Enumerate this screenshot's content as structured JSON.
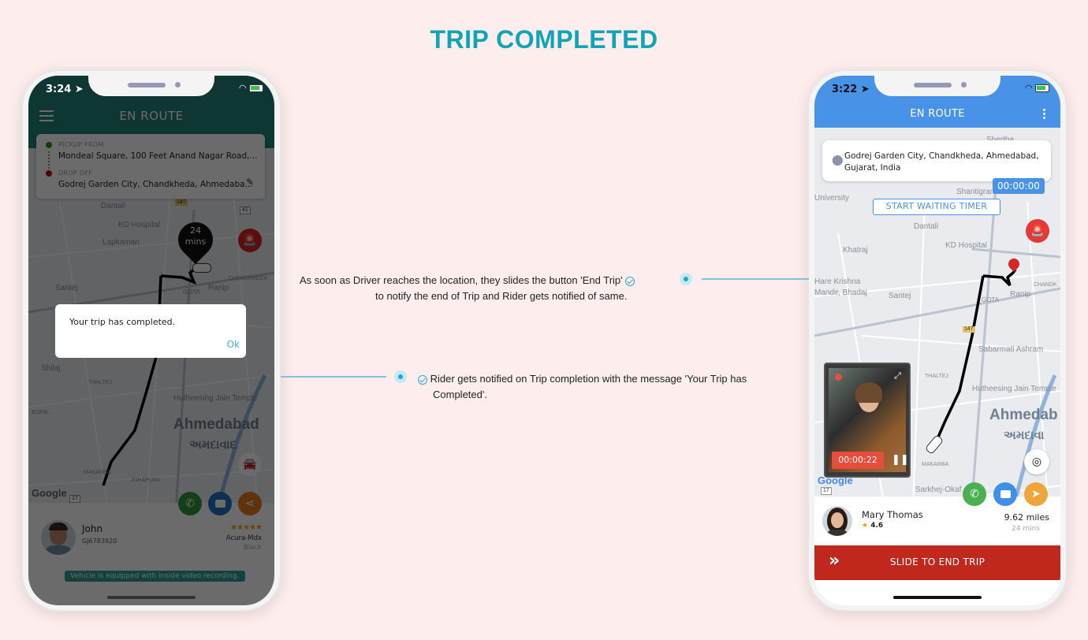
{
  "page": {
    "title": "TRIP COMPLETED",
    "accent_color": "#0fa4b8"
  },
  "callouts": [
    {
      "line1": "As soon as Driver reaches the location, they slides the button 'End Trip'",
      "line2": "to notify the end of Trip and Rider gets notified of same.",
      "icon": "check-circle-icon"
    },
    {
      "line1": "Rider gets notified on Trip completion with the message 'Your Trip has",
      "line2": "Completed'.",
      "icon": "check-circle-icon"
    }
  ],
  "rider_phone": {
    "status_time": "3:24",
    "header_title": "EN ROUTE",
    "header_color": "#23807a",
    "pickup_label": "PICKUP FROM",
    "pickup_address": "Mondeal Square, 100 Feet Anand Nagar Road,...",
    "dropoff_label": "DROP OFF",
    "dropoff_address": "Godrej Garden City, Chandkheda, Ahmedaba...",
    "eta_value": "24",
    "eta_unit": "mins",
    "dialog": {
      "message": "Your trip has completed.",
      "ok_label": "Ok"
    },
    "map_labels": {
      "dantali": "Dantali",
      "kd_hospital": "KD Hospital",
      "lapkaman": "Lapkaman",
      "chandkheda": "CHANDKHEDA",
      "gota": "GOTA",
      "ranip": "Ranip",
      "santej": "Santej",
      "shilaj": "Shilaj",
      "thaltej": "THALTEJ",
      "bopal": "BOPAL",
      "hutheesing": "Hutheesing Jain Temple",
      "city": "Ahmedabad",
      "city_gujarati": "અમદાવાદ",
      "makarba": "MAKARBA",
      "juhapura": "JUHAPURA",
      "road_147": "147",
      "road_41": "41",
      "road_17": "17",
      "google": "Google"
    },
    "driver": {
      "name": "John",
      "plate": "GJ6783920",
      "rating_stars": 4.5,
      "stars_display": "★★★★★",
      "vehicle": "Acura-Mdx",
      "color": "Black"
    },
    "notice": "Vehicle is equipped with inside video recording.",
    "actions": [
      {
        "name": "call",
        "glyph": "✆",
        "color": "#2f9a3c"
      },
      {
        "name": "chat",
        "glyph": "▬",
        "color": "#1f72c4"
      },
      {
        "name": "share",
        "glyph": "⋖",
        "color": "#e07b22"
      }
    ]
  },
  "driver_phone": {
    "status_time": "3:22",
    "header_title": "EN ROUTE",
    "header_color": "#4893e8",
    "destination": "Godrej Garden City, Chandkheda, Ahmedabad, Gujarat, India",
    "waiting_timer": "00:00:00",
    "start_waiting_label": "START WAITING TIMER",
    "recording_timer": "00:00:22",
    "map_labels": {
      "shertha": "Shertha",
      "shantigram": "Shantigram",
      "university": "University",
      "dantali": "Dantali",
      "kd_hospital": "KD Hospital",
      "khatraj": "Khatraj",
      "hare_krishna": "Hare Krishna",
      "bhadaj": "Mandir, Bhadaj",
      "santej": "Santej",
      "gota": "GOTA",
      "ranip": "Ranip",
      "chandk": "CHANDK",
      "sabarmati": "Sabarmati Ashram",
      "thaltej": "THALTEJ",
      "hutheesing": "Hutheesing Jain Temple",
      "city": "Ahmedab",
      "city_gujarati": "અમદાવા",
      "makarba": "MAKARBA",
      "sarkhej": "Sarkhej-Okaf",
      "road_147": "147",
      "road_17": "17",
      "google": "Google"
    },
    "rider": {
      "name": "Mary Thomas",
      "rating": "4.6",
      "distance": "9.62 miles",
      "duration": "24 mins"
    },
    "actions": [
      {
        "name": "call",
        "glyph": "✆",
        "color": "#4caf50"
      },
      {
        "name": "chat",
        "glyph": "▬",
        "color": "#3f8fe8"
      },
      {
        "name": "navigate",
        "glyph": "➤",
        "color": "#eea53a"
      }
    ],
    "slide_label": "SLIDE TO END TRIP",
    "slide_color": "#c0281e"
  }
}
